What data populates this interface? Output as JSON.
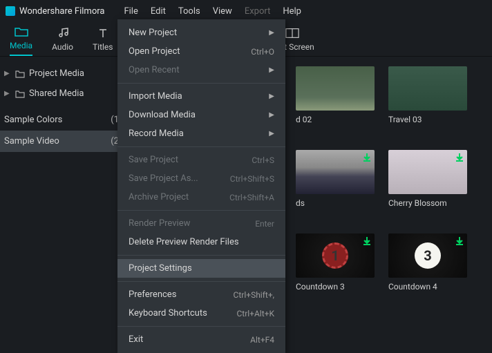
{
  "app": {
    "title": "Wondershare Filmora"
  },
  "menubar": [
    "File",
    "Edit",
    "Tools",
    "View",
    "Export",
    "Help"
  ],
  "menubar_disabled": [
    4
  ],
  "toolbar": [
    {
      "label": "Media",
      "icon": "folder"
    },
    {
      "label": "Audio",
      "icon": "music"
    },
    {
      "label": "Titles",
      "icon": "text"
    },
    {
      "label": "Split Screen",
      "icon": "split"
    }
  ],
  "sidebar": {
    "tree": [
      {
        "label": "Project Media"
      },
      {
        "label": "Shared Media"
      }
    ],
    "list": [
      {
        "label": "Sample Colors",
        "count": "(1"
      },
      {
        "label": "Sample Video",
        "count": "(2",
        "selected": true
      }
    ]
  },
  "thumbs": [
    {
      "label": "d 02",
      "bg": "bg-travel2"
    },
    {
      "label": "Travel 03",
      "bg": "bg-travel3"
    },
    {
      "label": "ds",
      "bg": "bg-islands",
      "dl": true
    },
    {
      "label": "Cherry Blossom",
      "bg": "bg-cherry",
      "dl": true
    },
    {
      "label": "Countdown 3",
      "bg": "bg-count",
      "dl": true,
      "count": "1",
      "count_style": "cc-red"
    },
    {
      "label": "Countdown 4",
      "bg": "bg-count",
      "dl": true,
      "count": "3",
      "count_style": "cc-white"
    }
  ],
  "file_menu": [
    {
      "label": "New Project",
      "arrow": true
    },
    {
      "label": "Open Project",
      "shortcut": "Ctrl+O"
    },
    {
      "label": "Open Recent",
      "arrow": true,
      "disabled": true
    },
    {
      "sep": true
    },
    {
      "label": "Import Media",
      "arrow": true
    },
    {
      "label": "Download Media",
      "arrow": true
    },
    {
      "label": "Record Media",
      "arrow": true
    },
    {
      "sep": true
    },
    {
      "label": "Save Project",
      "shortcut": "Ctrl+S",
      "disabled": true
    },
    {
      "label": "Save Project As...",
      "shortcut": "Ctrl+Shift+S",
      "disabled": true
    },
    {
      "label": "Archive Project",
      "shortcut": "Ctrl+Shift+A",
      "disabled": true
    },
    {
      "sep": true
    },
    {
      "label": "Render Preview",
      "shortcut": "Enter",
      "disabled": true
    },
    {
      "label": "Delete Preview Render Files"
    },
    {
      "sep": true
    },
    {
      "label": "Project Settings",
      "highlighted": true
    },
    {
      "sep": true
    },
    {
      "label": "Preferences",
      "shortcut": "Ctrl+Shift+,"
    },
    {
      "label": "Keyboard Shortcuts",
      "shortcut": "Ctrl+Alt+K"
    },
    {
      "sep": true
    },
    {
      "label": "Exit",
      "shortcut": "Alt+F4"
    }
  ]
}
